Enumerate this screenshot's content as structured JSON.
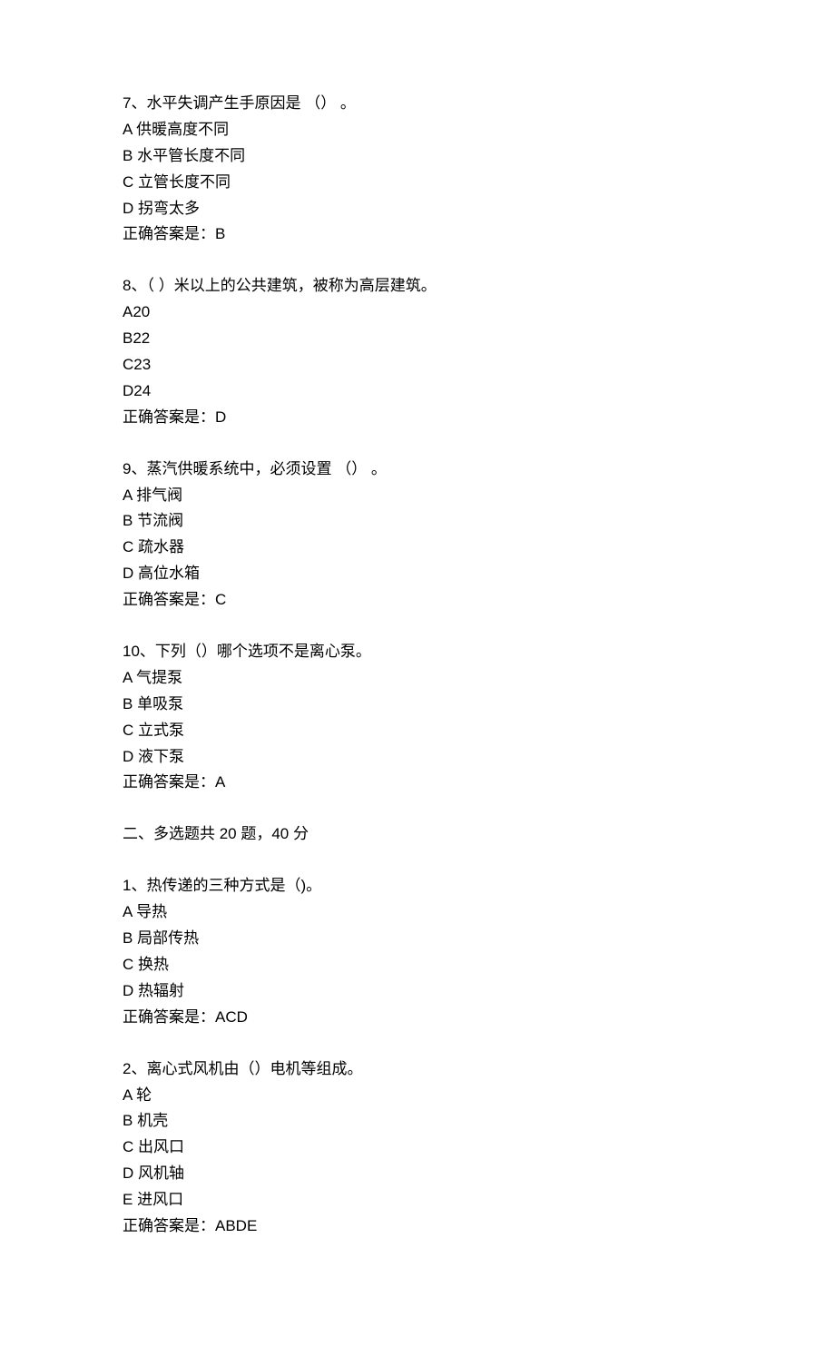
{
  "questions_single": [
    {
      "number": "7、",
      "text": "水平失调产生手原因是 （） 。",
      "options": [
        {
          "label": "A",
          "text": "供暖高度不同"
        },
        {
          "label": "B",
          "text": "水平管长度不同"
        },
        {
          "label": "C",
          "text": "立管长度不同"
        },
        {
          "label": "D",
          "text": "拐弯太多"
        }
      ],
      "answer_label": "正确答案是：",
      "answer": "B"
    },
    {
      "number": "8、",
      "text": "（  ）米以上的公共建筑，被称为高层建筑。",
      "options": [
        {
          "label": "A",
          "text": "20"
        },
        {
          "label": "B",
          "text": "22"
        },
        {
          "label": "C",
          "text": "23"
        },
        {
          "label": "D",
          "text": "24"
        }
      ],
      "answer_label": "正确答案是：",
      "answer": "D"
    },
    {
      "number": "9、",
      "text": "蒸汽供暖系统中，必须设置 （） 。",
      "options": [
        {
          "label": "A",
          "text": "排气阀"
        },
        {
          "label": "B",
          "text": "节流阀"
        },
        {
          "label": "C",
          "text": "疏水器"
        },
        {
          "label": "D",
          "text": "高位水箱"
        }
      ],
      "answer_label": "正确答案是：",
      "answer": "C"
    },
    {
      "number": "10、",
      "text": "下列（）哪个选项不是离心泵。",
      "options": [
        {
          "label": "A",
          "text": "气提泵"
        },
        {
          "label": "B",
          "text": "单吸泵"
        },
        {
          "label": "C",
          "text": "立式泵"
        },
        {
          "label": "D",
          "text": "液下泵"
        }
      ],
      "answer_label": "正确答案是：",
      "answer": "A"
    }
  ],
  "section_header": "二、多选题共 20 题，40 分",
  "questions_multi": [
    {
      "number": "1、",
      "text": "热传递的三种方式是（)。",
      "options": [
        {
          "label": "A",
          "text": "导热"
        },
        {
          "label": "B",
          "text": "局部传热"
        },
        {
          "label": "C",
          "text": "换热"
        },
        {
          "label": "D",
          "text": "热辐射"
        }
      ],
      "answer_label": "正确答案是：",
      "answer": "ACD"
    },
    {
      "number": "2、",
      "text": "离心式风机由（）电机等组成。",
      "options": [
        {
          "label": "A",
          "text": "轮"
        },
        {
          "label": "B",
          "text": "机壳"
        },
        {
          "label": "C",
          "text": "出风口"
        },
        {
          "label": "D",
          "text": "风机轴"
        },
        {
          "label": "E",
          "text": "进风口"
        }
      ],
      "answer_label": "正确答案是：",
      "answer": "ABDE"
    }
  ]
}
